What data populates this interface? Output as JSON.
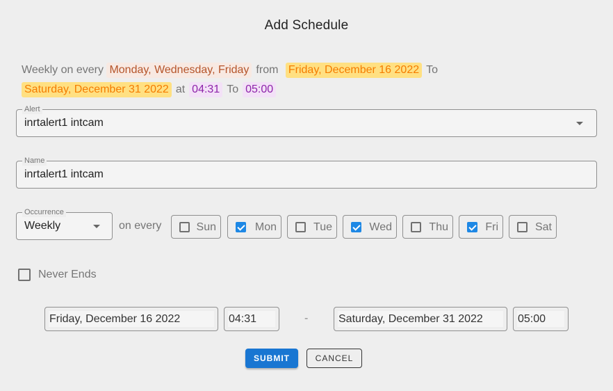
{
  "dialog": {
    "title": "Add Schedule"
  },
  "summary": {
    "prefix": "Weekly on every",
    "days": "Monday, Wednesday, Friday",
    "from_word": "from",
    "start_date": "Friday, December 16 2022",
    "to_word": "To",
    "end_date": "Saturday, December 31 2022",
    "at_word": "at",
    "start_time": "04:31",
    "to_word_2": "To",
    "end_time": "05:00"
  },
  "alert_field": {
    "label": "Alert",
    "value": "inrtalert1 intcam",
    "icon": "caret-down-icon"
  },
  "name_field": {
    "label": "Name",
    "value": "inrtalert1 intcam"
  },
  "occurrence": {
    "label": "Occurrence",
    "value": "Weekly",
    "on_every_label": "on every"
  },
  "weekdays": [
    {
      "label": "Sun",
      "checked": false
    },
    {
      "label": "Mon",
      "checked": true
    },
    {
      "label": "Tue",
      "checked": false
    },
    {
      "label": "Wed",
      "checked": true
    },
    {
      "label": "Thu",
      "checked": false
    },
    {
      "label": "Fri",
      "checked": true
    },
    {
      "label": "Sat",
      "checked": false
    }
  ],
  "never_ends": {
    "label": "Never Ends",
    "checked": false
  },
  "range": {
    "start_date": "Friday, December 16 2022",
    "start_time": "04:31",
    "separator": "-",
    "end_date": "Saturday, December 31 2022",
    "end_time": "05:00"
  },
  "actions": {
    "submit_label": "SUBMIT",
    "cancel_label": "CANCEL"
  },
  "colors": {
    "primary": "#1976d2",
    "checkbox_checked": "#1e88e5",
    "days_highlight_bg": "#f8e9e2",
    "days_highlight_text": "#b5552b",
    "date_highlight_bg": "#ffe082",
    "date_highlight_text": "#f57c00",
    "time_highlight_bg": "#f3e1f7",
    "time_highlight_text": "#8e24aa"
  }
}
